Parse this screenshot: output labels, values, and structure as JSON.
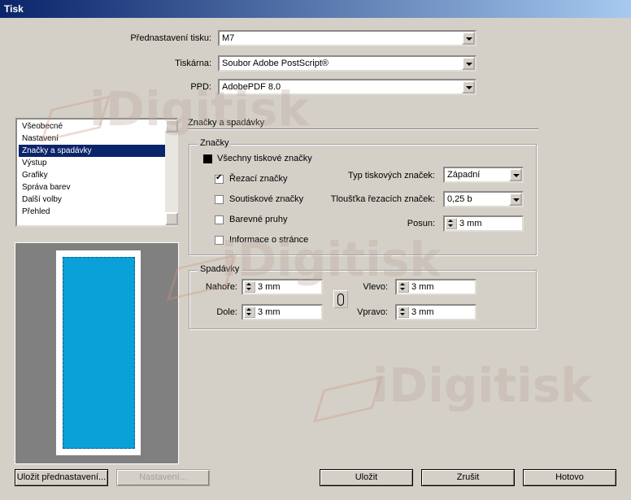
{
  "window": {
    "title": "Tisk"
  },
  "preset": {
    "label": "Přednastavení tisku:",
    "value": "M7"
  },
  "printer": {
    "label": "Tiskárna:",
    "value": "Soubor Adobe PostScript®"
  },
  "ppd": {
    "label": "PPD:",
    "value": "AdobePDF 8.0"
  },
  "sidebar": {
    "items": [
      {
        "label": "Všeobecné"
      },
      {
        "label": "Nastavení"
      },
      {
        "label": "Značky a spadávky"
      },
      {
        "label": "Výstup"
      },
      {
        "label": "Grafiky"
      },
      {
        "label": "Správa barev"
      },
      {
        "label": "Další volby"
      },
      {
        "label": "Přehled"
      }
    ],
    "selected_index": 2
  },
  "section_title": "Značky a spadávky",
  "marks": {
    "group_title": "Značky",
    "all_marks_label": "Všechny tiskové značky",
    "crop_marks_label": "Řezací značky",
    "registration_marks_label": "Soutiskové značky",
    "color_bars_label": "Barevné pruhy",
    "page_info_label": "Informace o stránce",
    "type_label": "Typ tiskových značek:",
    "type_value": "Západní",
    "weight_label": "Tloušťka řezacích značek:",
    "weight_value": "0,25 b",
    "offset_label": "Posun:",
    "offset_value": "3 mm"
  },
  "bleed": {
    "group_title": "Spadávky",
    "top_label": "Nahoře:",
    "top_value": "3 mm",
    "bottom_label": "Dole:",
    "bottom_value": "3 mm",
    "left_label": "Vlevo:",
    "left_value": "3 mm",
    "right_label": "Vpravo:",
    "right_value": "3 mm"
  },
  "buttons": {
    "save_preset": "Uložit přednastavení...",
    "setup": "Nastavení...",
    "save": "Uložit",
    "cancel": "Zrušit",
    "done": "Hotovo"
  },
  "watermark": {
    "text": "iDigitisk"
  },
  "colors": {
    "titlebar": "#0a246a",
    "selection": "#0a246a",
    "preview_page": "#0aa0d8"
  }
}
